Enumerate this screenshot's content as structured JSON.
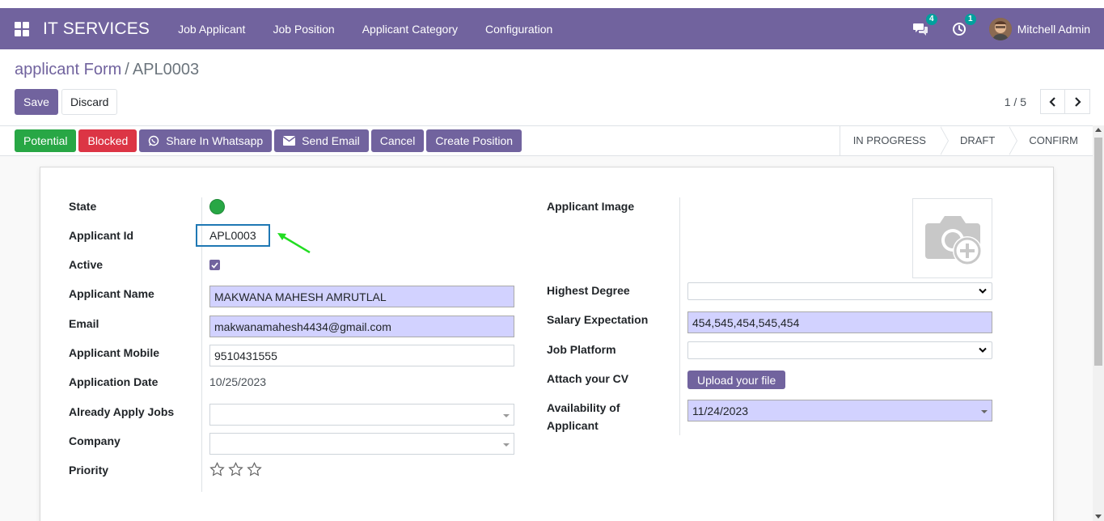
{
  "navbar": {
    "brand": "IT SERVICES",
    "menu": [
      "Job Applicant",
      "Job Position",
      "Applicant Category",
      "Configuration"
    ],
    "messages_count": "4",
    "activities_count": "1",
    "user_name": "Mitchell Admin"
  },
  "breadcrumb": {
    "parent": "applicant Form",
    "separator": "/",
    "current": "APL0003"
  },
  "control": {
    "save_label": "Save",
    "discard_label": "Discard",
    "pager": "1 / 5"
  },
  "statusbar": {
    "buttons": {
      "potential": "Potential",
      "blocked": "Blocked",
      "whatsapp": "Share In Whatsapp",
      "email": "Send Email",
      "cancel": "Cancel",
      "create_position": "Create Position"
    },
    "stages": [
      "IN PROGRESS",
      "DRAFT",
      "CONFIRM"
    ]
  },
  "form": {
    "left": {
      "state_label": "State",
      "applicant_id_label": "Applicant Id",
      "applicant_id": "APL0003",
      "active_label": "Active",
      "name_label": "Applicant Name",
      "name": "MAKWANA MAHESH AMRUTLAL",
      "email_label": "Email",
      "email": "makwanamahesh4434@gmail.com",
      "mobile_label": "Applicant Mobile",
      "mobile": "9510431555",
      "date_label": "Application Date",
      "date": "10/25/2023",
      "already_apply_label": "Already Apply Jobs",
      "already_apply": "",
      "company_label": "Company",
      "company": "",
      "priority_label": "Priority"
    },
    "right": {
      "image_label": "Applicant Image",
      "degree_label": "Highest Degree",
      "degree": "",
      "salary_label": "Salary Expectation",
      "salary": "454,545,454,545,454",
      "platform_label": "Job Platform",
      "platform": "",
      "cv_label": "Attach your CV",
      "upload_label": "Upload your file",
      "availability_label_1": "Availability of",
      "availability_label_2": "Applicant",
      "availability": "11/24/2023"
    }
  },
  "colors": {
    "brand": "#71639e",
    "success": "#28a745",
    "danger": "#dc3545",
    "required_field": "#d2d2ff",
    "annotation_box": "#1f78b4",
    "annotation_arrow": "#22dd22"
  },
  "icons": [
    "apps-grid-icon",
    "chat-icon",
    "clock-icon",
    "chevron-left-icon",
    "chevron-right-icon",
    "whatsapp-icon",
    "envelope-icon",
    "camera-plus-icon",
    "star-icon",
    "check-icon"
  ]
}
